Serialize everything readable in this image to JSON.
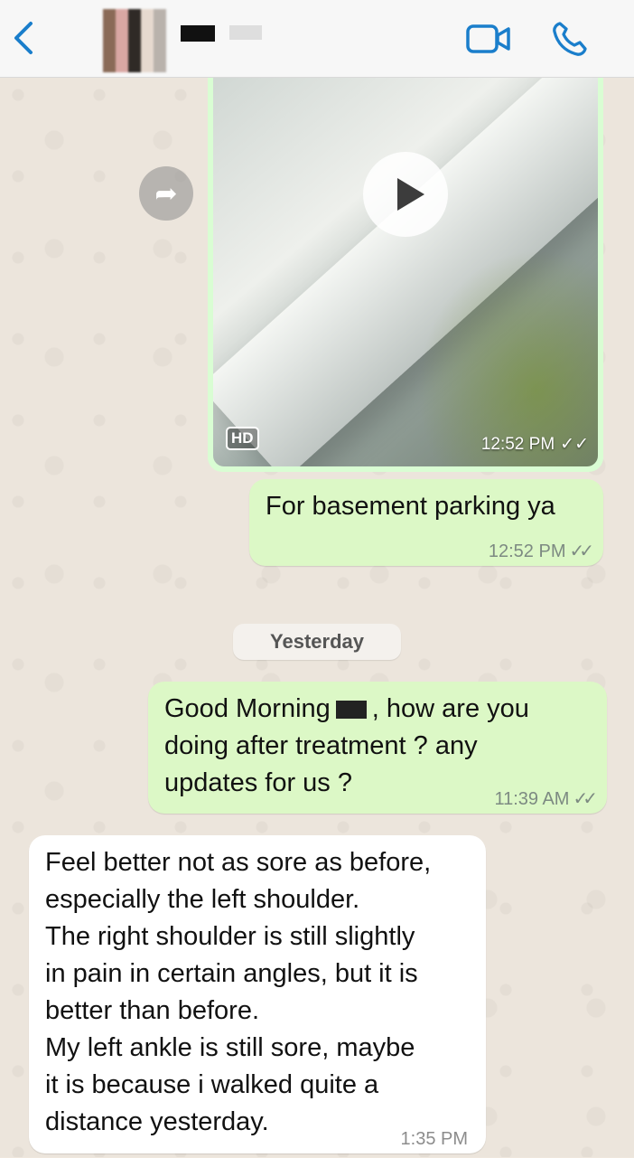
{
  "header": {
    "back_icon": "chevron-left-icon",
    "video_call_icon": "video-camera-icon",
    "voice_call_icon": "phone-icon"
  },
  "messages": {
    "video": {
      "hd_label": "HD",
      "time": "12:52 PM"
    },
    "basement": {
      "text": "For basement parking ya",
      "time": "12:52 PM"
    },
    "day_separator": "Yesterday",
    "good_morning": {
      "text_before": "Good Morning",
      "text_after": ", how are you\ndoing after treatment ? any\nupdates for us ?",
      "time": "11:39 AM"
    },
    "reply": {
      "text": "Feel better not as sore as before,\nespecially the left shoulder.\nThe right shoulder is still slightly\nin pain in certain angles, but it is\nbetter than before.\nMy left ankle is still sore, maybe\nit is because i walked quite a\ndistance yesterday.",
      "time": "1:35 PM"
    }
  },
  "colors": {
    "accent": "#1a7ecb",
    "outgoing_bubble": "#dcf8c6",
    "incoming_bubble": "#ffffff"
  }
}
